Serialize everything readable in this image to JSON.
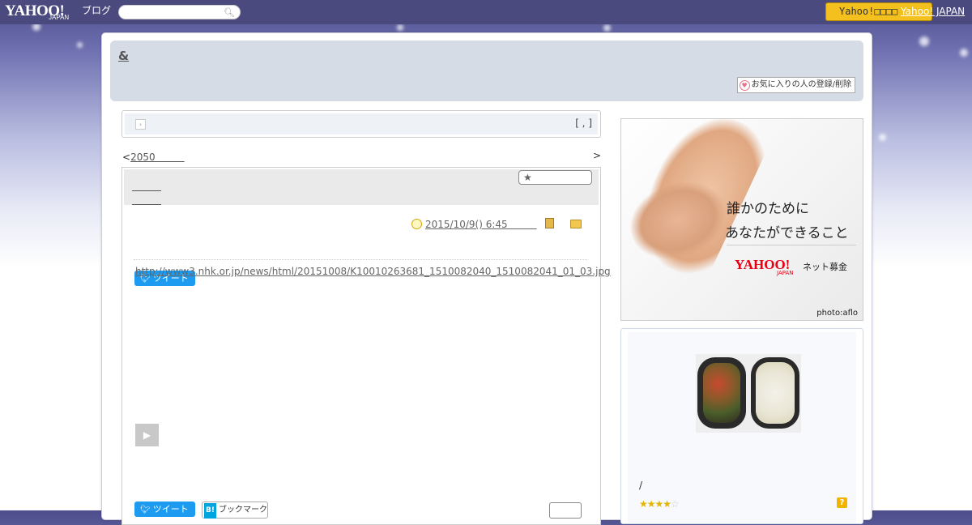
{
  "header": {
    "logo_text": "YAHOO!",
    "logo_sub": "JAPAN",
    "logo_blog": "ブログ",
    "search_placeholder": "",
    "yahoo_button_label": "Yahoo!□□□□",
    "yahoo_japan_link": "Yahoo! JAPAN"
  },
  "blog": {
    "title": "&",
    "favorite_button_label": "お気に入りの人の登録/削除"
  },
  "breadcrumb": {
    "right_text": "[ , ]"
  },
  "nav": {
    "prev_symbol": "<",
    "prev_link": "2050　　　",
    "next_symbol": ">"
  },
  "article": {
    "head_link_1": "　　　",
    "head_link_2": "　　　",
    "favorite_star_label": "",
    "date": "2015/10/9()  6:45　　　",
    "tweet_label": "ツイート",
    "url_text": "http://www3.nhk.or.jp/news/html/20151008/K10010263681_1510082040_1510082041_01_03.jpg",
    "play_label": "▶",
    "hatena_b": "B!",
    "hatena_label": "ブックマーク",
    "tweet_label_bottom": "ツイート"
  },
  "sidebar": {
    "ad": {
      "line1": "誰かのために",
      "line2": "あなたができること",
      "logo": "YAHOO!",
      "logo_sub": "JAPAN",
      "tagline": "ネット募金",
      "credit": "photo:aflo"
    },
    "profile": {
      "text": "/",
      "stars_filled": "★★★★",
      "stars_empty": "☆",
      "help": "?"
    }
  }
}
